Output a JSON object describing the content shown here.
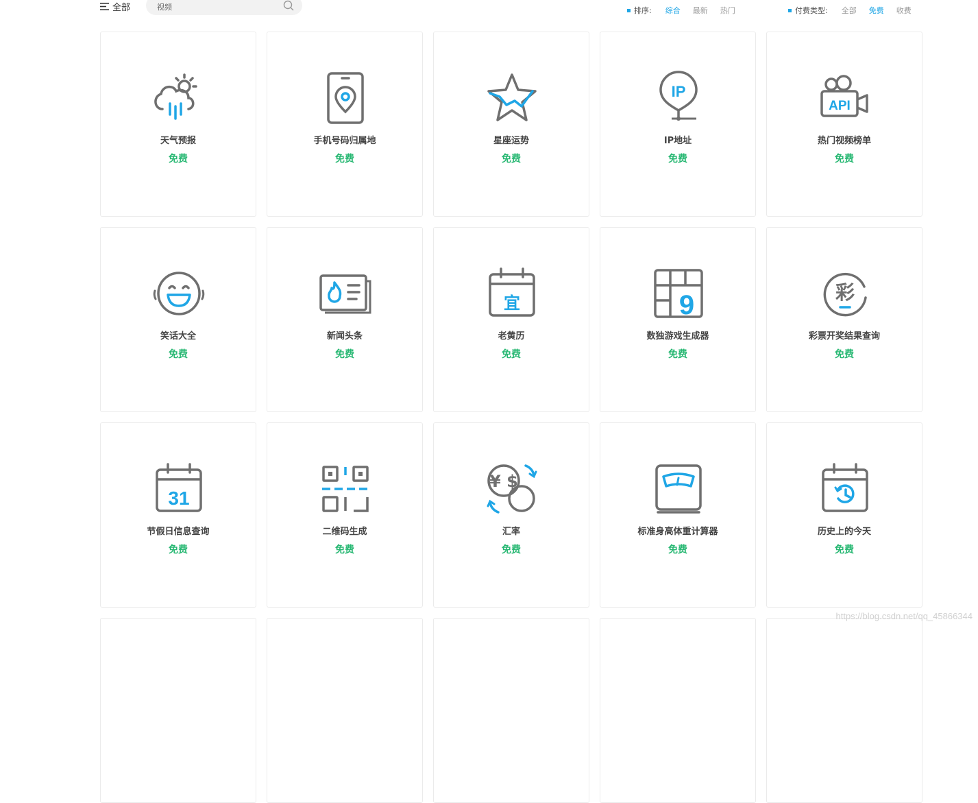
{
  "header": {
    "all_label": "全部",
    "search": {
      "value": "视频",
      "placeholder": ""
    },
    "sort": {
      "label": "排序:",
      "options": [
        "综合",
        "最新",
        "热门"
      ],
      "active": 0
    },
    "pay_type": {
      "label": "付费类型:",
      "options": [
        "全部",
        "免费",
        "收费"
      ],
      "active": 1
    }
  },
  "cards": [
    {
      "name": "天气预报",
      "price": "免费",
      "icon": "weather-icon"
    },
    {
      "name": "手机号码归属地",
      "price": "免费",
      "icon": "phone-location-icon"
    },
    {
      "name": "星座运势",
      "price": "免费",
      "icon": "star-icon"
    },
    {
      "name": "IP地址",
      "price": "免费",
      "icon": "ip-location-icon",
      "icon_text": "IP"
    },
    {
      "name": "热门视频榜单",
      "price": "免费",
      "icon": "video-camera-icon",
      "icon_text": "API"
    },
    {
      "name": "笑话大全",
      "price": "免费",
      "icon": "laughing-face-icon"
    },
    {
      "name": "新闻头条",
      "price": "免费",
      "icon": "newspaper-icon"
    },
    {
      "name": "老黄历",
      "price": "免费",
      "icon": "almanac-calendar-icon",
      "icon_text": "宜"
    },
    {
      "name": "数独游戏生成器",
      "price": "免费",
      "icon": "sudoku-icon",
      "icon_text": "9"
    },
    {
      "name": "彩票开奖结果查询",
      "price": "免费",
      "icon": "lottery-icon",
      "icon_text": "彩"
    },
    {
      "name": "节假日信息查询",
      "price": "免费",
      "icon": "holiday-calendar-icon",
      "icon_text": "31"
    },
    {
      "name": "二维码生成",
      "price": "免费",
      "icon": "qr-code-icon"
    },
    {
      "name": "汇率",
      "price": "免费",
      "icon": "exchange-rate-icon",
      "icon_text": "¥ $"
    },
    {
      "name": "标准身高体重计算器",
      "price": "免费",
      "icon": "scale-icon"
    },
    {
      "name": "历史上的今天",
      "price": "免费",
      "icon": "history-calendar-icon"
    }
  ],
  "watermark": "https://blog.csdn.net/qq_45866344",
  "colors": {
    "accent": "#1fa6e6",
    "free": "#28b873",
    "icon_gray": "#6f6f6f"
  }
}
